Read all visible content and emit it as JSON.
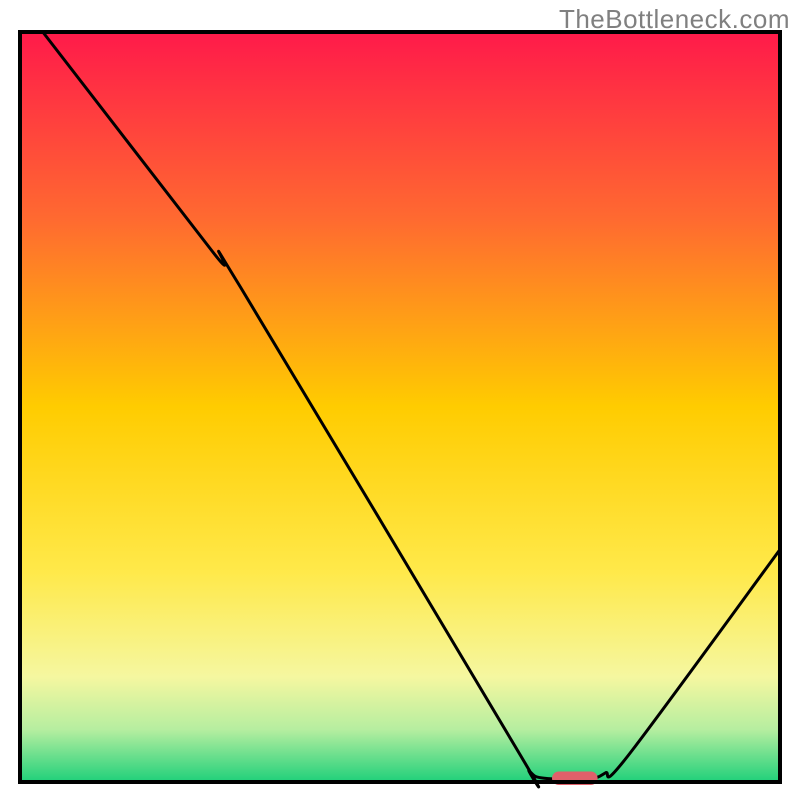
{
  "attribution": "TheBottleneck.com",
  "chart_data": {
    "type": "line",
    "title": "",
    "xlabel": "",
    "ylabel": "",
    "xlim": [
      0,
      100
    ],
    "ylim": [
      0,
      100
    ],
    "background_gradient": {
      "stops": [
        {
          "offset": 0.0,
          "color": "#ff1a4a"
        },
        {
          "offset": 0.25,
          "color": "#ff6a30"
        },
        {
          "offset": 0.5,
          "color": "#ffcc00"
        },
        {
          "offset": 0.72,
          "color": "#ffe94a"
        },
        {
          "offset": 0.86,
          "color": "#f5f7a0"
        },
        {
          "offset": 0.93,
          "color": "#b6eea0"
        },
        {
          "offset": 1.0,
          "color": "#1fd07a"
        }
      ]
    },
    "curve": {
      "name": "bottleneck-curve",
      "color": "#000000",
      "points": [
        {
          "x": 3.0,
          "y": 100.0
        },
        {
          "x": 25.5,
          "y": 70.5
        },
        {
          "x": 29.0,
          "y": 66.0
        },
        {
          "x": 65.0,
          "y": 5.0
        },
        {
          "x": 67.0,
          "y": 1.5
        },
        {
          "x": 69.0,
          "y": 0.5
        },
        {
          "x": 75.0,
          "y": 0.5
        },
        {
          "x": 77.0,
          "y": 1.2
        },
        {
          "x": 80.0,
          "y": 3.5
        },
        {
          "x": 100.0,
          "y": 31.0
        }
      ]
    },
    "marker": {
      "name": "optimal-marker",
      "color": "#e0606a",
      "x": 73.0,
      "y": 0.5,
      "width": 6.0,
      "height": 1.8
    },
    "frame_color": "#000000"
  }
}
